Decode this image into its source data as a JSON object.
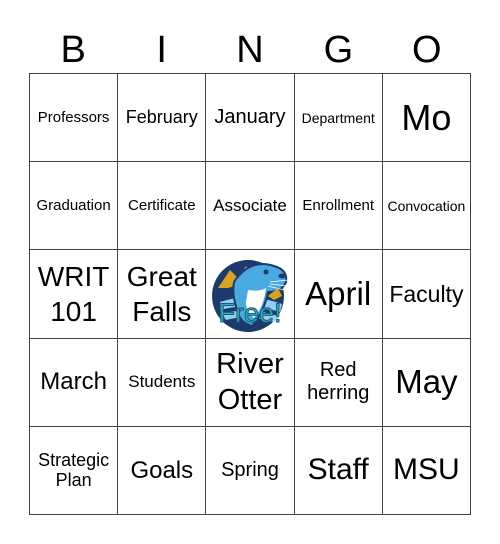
{
  "header": [
    "B",
    "I",
    "N",
    "G",
    "O"
  ],
  "cells": [
    [
      "Professors",
      "February",
      "January",
      "Department",
      "Mo"
    ],
    [
      "Graduation",
      "Certificate",
      "Associate",
      "Enrollment",
      "Convocation"
    ],
    [
      "WRIT 101",
      "Great Falls",
      "FREE",
      "April",
      "Faculty"
    ],
    [
      "March",
      "Students",
      "River Otter",
      "Red herring",
      "May"
    ],
    [
      "Strategic Plan",
      "Goals",
      "Spring",
      "Staff",
      "MSU"
    ]
  ],
  "free_space": {
    "label": "Free!",
    "icon": "river-otter-mascot-icon"
  },
  "colors": {
    "otter_blue": "#4aa9e0",
    "navy": "#1d3a6e",
    "gold": "#d9a322",
    "free_text": "#2fb0c9"
  }
}
